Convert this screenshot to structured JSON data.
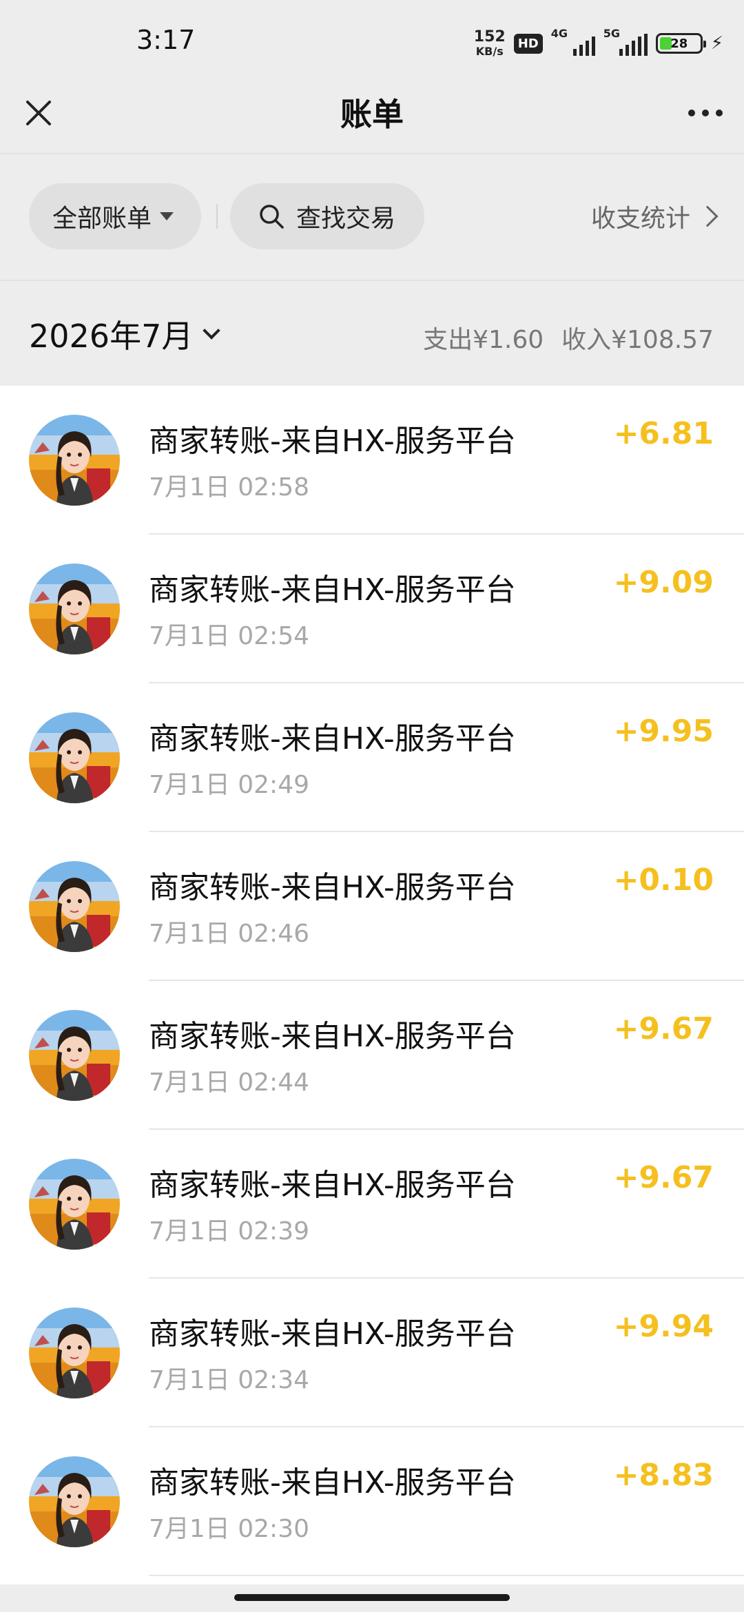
{
  "status_bar": {
    "time": "3:17",
    "net_speed_value": "152",
    "net_speed_unit": "KB/s",
    "hd_badge": "HD",
    "signal_1_label": "4G",
    "signal_2_label": "5G",
    "battery_level": "28",
    "battery_fill_fraction": 0.28,
    "icons": [
      "hd-icon",
      "signal-4g-icon",
      "signal-5g-icon",
      "battery-icon",
      "charging-icon"
    ]
  },
  "header": {
    "title": "账单",
    "left_icon": "close-icon",
    "right_icon": "more-icon"
  },
  "filters": {
    "all_bills_label": "全部账单",
    "search_label": "查找交易",
    "stats_label": "收支统计"
  },
  "month": {
    "label": "2026年7月",
    "expense": "支出¥1.60",
    "income": "收入¥108.57"
  },
  "colors": {
    "amount": "#f5c01f",
    "background": "#ededed",
    "list_background": "#ffffff",
    "time_text": "#a8a8a8"
  },
  "transactions": [
    {
      "name": "商家转账-来自HX-服务平台",
      "time": "7月1日 02:58",
      "amount": "+6.81"
    },
    {
      "name": "商家转账-来自HX-服务平台",
      "time": "7月1日 02:54",
      "amount": "+9.09"
    },
    {
      "name": "商家转账-来自HX-服务平台",
      "time": "7月1日 02:49",
      "amount": "+9.95"
    },
    {
      "name": "商家转账-来自HX-服务平台",
      "time": "7月1日 02:46",
      "amount": "+0.10"
    },
    {
      "name": "商家转账-来自HX-服务平台",
      "time": "7月1日 02:44",
      "amount": "+9.67"
    },
    {
      "name": "商家转账-来自HX-服务平台",
      "time": "7月1日 02:39",
      "amount": "+9.67"
    },
    {
      "name": "商家转账-来自HX-服务平台",
      "time": "7月1日 02:34",
      "amount": "+9.94"
    },
    {
      "name": "商家转账-来自HX-服务平台",
      "time": "7月1日 02:30",
      "amount": "+8.83"
    }
  ]
}
